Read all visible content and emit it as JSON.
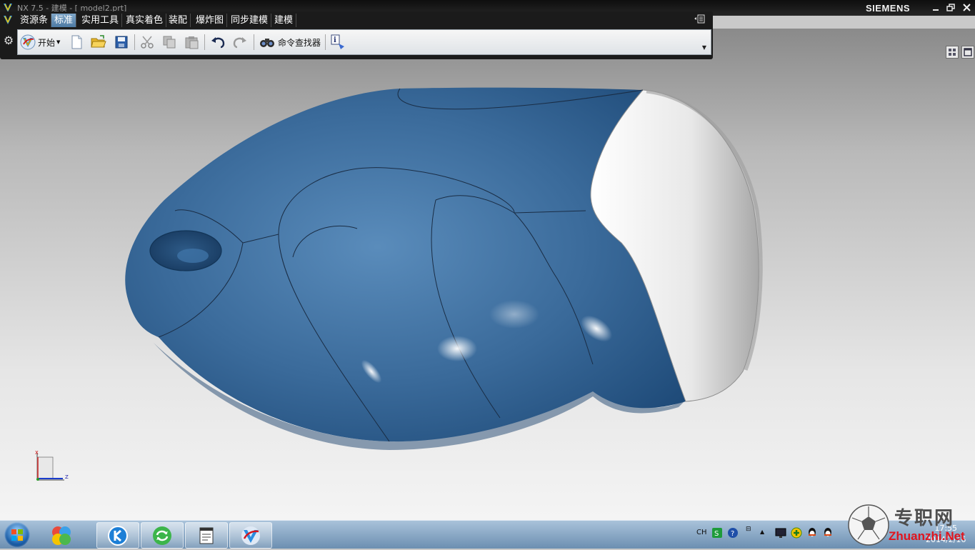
{
  "window": {
    "title": "NX 7.5 - 建模 - [ model2.prt]",
    "brand": "SIEMENS",
    "controls": [
      "minimize",
      "restore",
      "close"
    ]
  },
  "ribbon": {
    "tabs": [
      {
        "label": "资源条",
        "active": false
      },
      {
        "label": "标准",
        "active": true
      },
      {
        "label": "实用工具",
        "active": false
      },
      {
        "label": "真实着色",
        "active": false
      },
      {
        "label": "装配",
        "active": false
      },
      {
        "label": "爆炸图",
        "active": false
      },
      {
        "label": "同步建模",
        "active": false
      },
      {
        "label": "建模",
        "active": false
      }
    ],
    "toolbar": {
      "start_label": "开始",
      "command_finder_label": "命令查找器",
      "icons": [
        "start-icon",
        "new-file-icon",
        "open-folder-icon",
        "save-icon",
        "cut-icon",
        "copy-icon",
        "paste-icon",
        "undo-icon",
        "redo-icon",
        "binoculars-icon",
        "info-icon"
      ]
    }
  },
  "viewport": {
    "triad": {
      "x_label": "X",
      "z_label": "Z"
    },
    "colors": {
      "body": "#3a6a9a",
      "cap": "#e6e6e6",
      "background_top": "#8a8a8a",
      "background_bottom": "#f4f4f4"
    }
  },
  "taskbar": {
    "tasks": [
      "start-menu",
      "app-launcher",
      "kugou-k",
      "refresh-app",
      "notepad-doc",
      "nx-app"
    ],
    "tray": {
      "language": "CH",
      "clock_time": "17:55",
      "clock_date": "2014/2/16"
    }
  },
  "watermark": {
    "chinese": "专职网",
    "english": "Zhuanzhi.Net"
  }
}
